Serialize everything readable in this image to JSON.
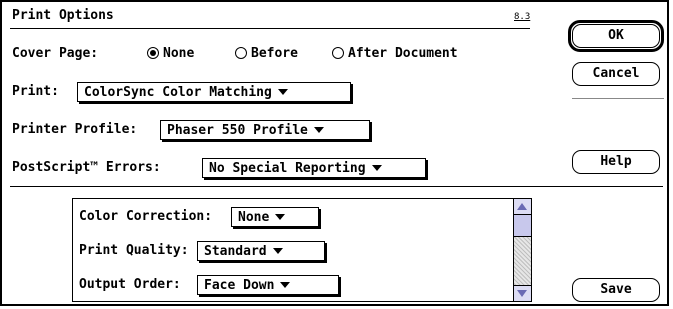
{
  "header": {
    "title": "Print Options",
    "version": "8.3"
  },
  "cover_page": {
    "label": "Cover Page:",
    "options": [
      {
        "label": "None",
        "selected": true
      },
      {
        "label": "Before",
        "selected": false
      },
      {
        "label": "After Document",
        "selected": false
      }
    ]
  },
  "print": {
    "label": "Print:",
    "value": "ColorSync Color Matching"
  },
  "printer_profile": {
    "label": "Printer Profile:",
    "value": "Phaser 550 Profile"
  },
  "postscript_errors": {
    "label": "PostScript™ Errors:",
    "value": "No Special Reporting"
  },
  "buttons": {
    "ok": "OK",
    "cancel": "Cancel",
    "help": "Help",
    "save": "Save"
  },
  "list": {
    "rows": [
      {
        "label": "Color Correction:",
        "value": "None"
      },
      {
        "label": "Print Quality:",
        "value": "Standard"
      },
      {
        "label": "Output Order:",
        "value": "Face Down"
      }
    ]
  },
  "icons": {
    "scroll_up": "scroll-up-arrow-icon",
    "scroll_down": "scroll-down-arrow-icon",
    "popup_arrow": "triangle-down-icon"
  },
  "colors": {
    "scroll_arrow": "#6a6ab4",
    "scroll_thumb": "#c8c8ec"
  }
}
